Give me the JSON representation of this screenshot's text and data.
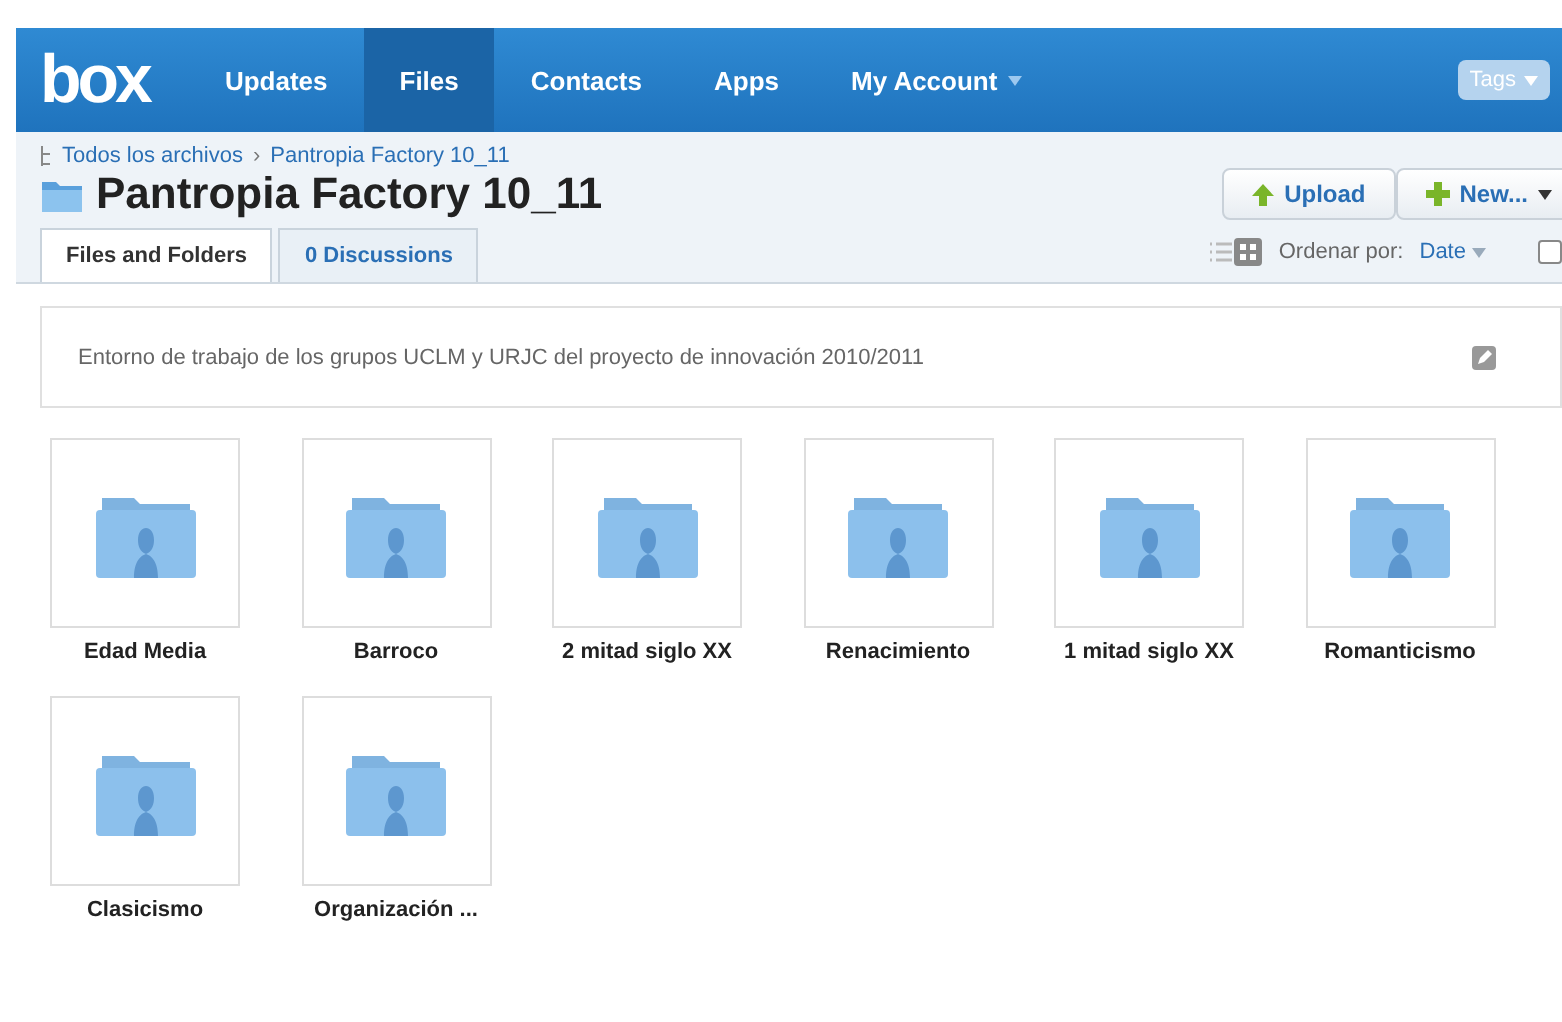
{
  "nav": {
    "logo": "box",
    "items": [
      {
        "label": "Updates",
        "selected": false,
        "caret": false
      },
      {
        "label": "Files",
        "selected": true,
        "caret": false
      },
      {
        "label": "Contacts",
        "selected": false,
        "caret": false
      },
      {
        "label": "Apps",
        "selected": false,
        "caret": false
      },
      {
        "label": "My Account",
        "selected": false,
        "caret": true
      }
    ],
    "tags": "Tags"
  },
  "breadcrumb": [
    {
      "label": "Todos los archivos"
    },
    {
      "separator": "›"
    },
    {
      "label": "Pantropia Factory 10_11"
    }
  ],
  "title": "Pantropia Factory 10_11",
  "tabs": [
    {
      "label": "Files and Folders",
      "selected": true
    },
    {
      "label": "0 Discussions",
      "selected": false
    }
  ],
  "actions": [
    {
      "kind": "upload",
      "label": "Upload"
    },
    {
      "kind": "new",
      "label": "New..."
    }
  ],
  "views": [
    {
      "kind": "list",
      "selected": false
    },
    {
      "kind": "grid",
      "selected": true
    }
  ],
  "sort": {
    "label": "Ordenar por:",
    "value": "Date"
  },
  "select_all": {
    "checked": false
  },
  "description": "Entorno de trabajo de los grupos UCLM y URJC del proyecto de innovación 2010/2011",
  "folders": [
    {
      "name": "Edad Media"
    },
    {
      "name": "Barroco"
    },
    {
      "name": "2 mitad siglo XX"
    },
    {
      "name": "Renacimiento"
    },
    {
      "name": "1 mitad siglo XX"
    },
    {
      "name": "Romanticismo"
    },
    {
      "name": "Clasicismo"
    },
    {
      "name": "Organización ..."
    }
  ]
}
